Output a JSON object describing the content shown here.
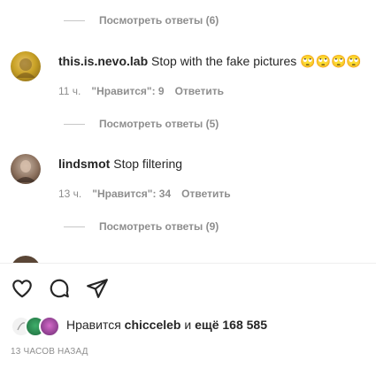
{
  "replies_top": {
    "label": "Посмотреть ответы (6)"
  },
  "comments": [
    {
      "username": "this.is.nevo.lab",
      "text": "Stop with the fake pictures 🙄🙄🙄🙄",
      "time": "11 ч.",
      "likes": "\"Нравится\": 9",
      "reply": "Ответить",
      "view_replies": "Посмотреть ответы (5)",
      "avatar_color": "#c9a227"
    },
    {
      "username": "lindsmot",
      "text": "Stop filtering",
      "time": "13 ч.",
      "likes": "\"Нравится\": 34",
      "reply": "Ответить",
      "view_replies": "Посмотреть ответы (9)",
      "avatar_color": "#8a6f5c"
    }
  ],
  "actions": {
    "like_icon": "heart-icon",
    "comment_icon": "comment-icon",
    "share_icon": "share-icon"
  },
  "likes_summary": {
    "prefix": "Нравится",
    "user": "chicceleb",
    "middle": "и",
    "rest": "ещё 168 585"
  },
  "timestamp": "13 ЧАСОВ НАЗАД"
}
